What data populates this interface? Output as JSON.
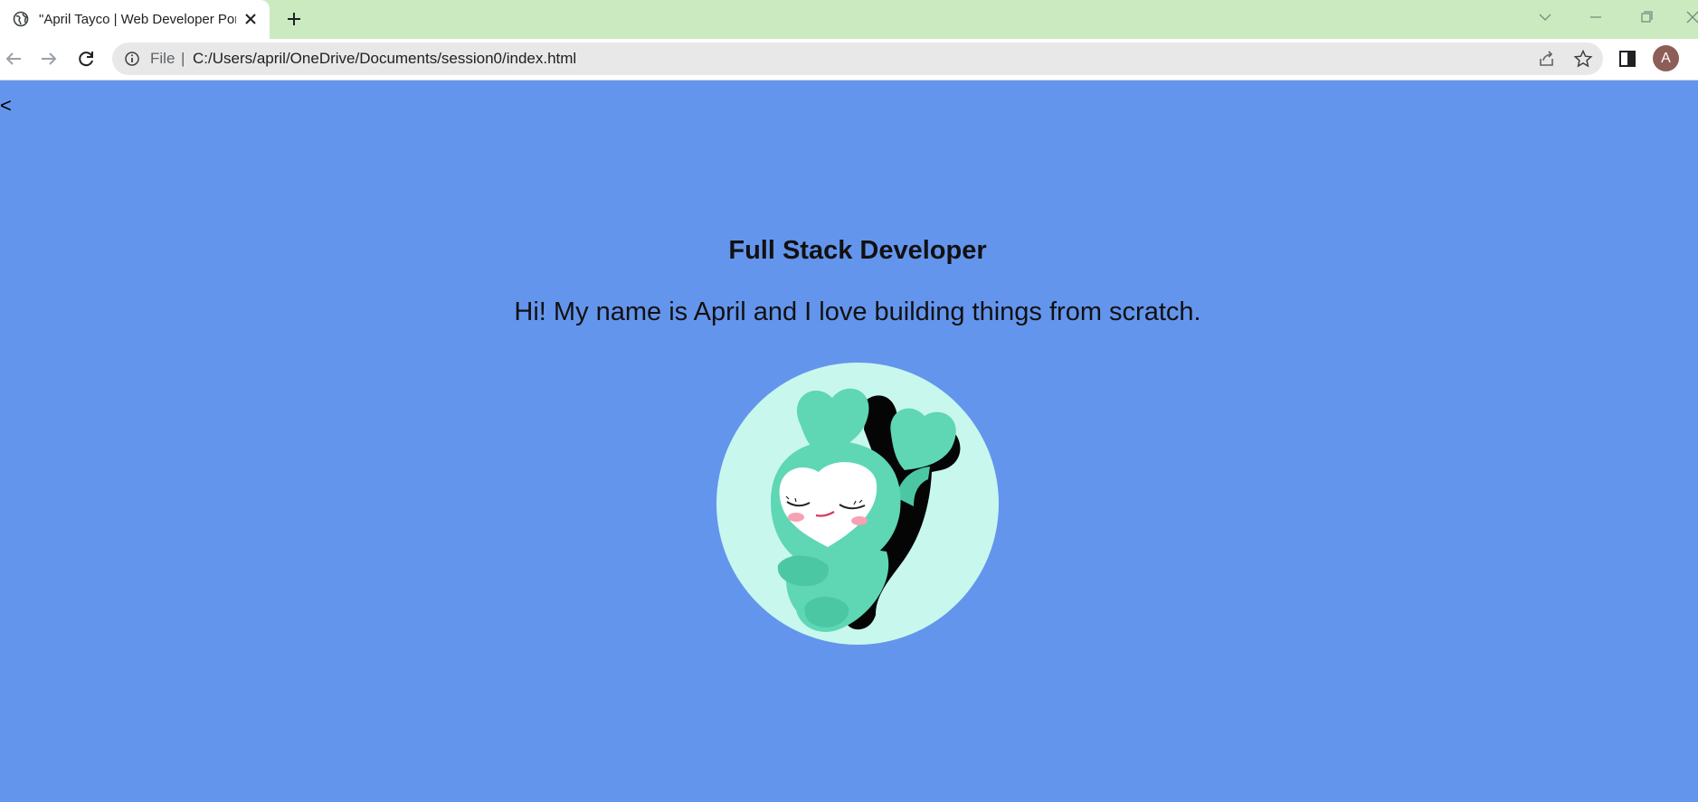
{
  "browser": {
    "tab": {
      "title": "\"April Tayco | Web Developer Portfolio\"",
      "favicon": "globe-icon",
      "close_icon": "close-icon"
    },
    "new_tab_icon": "plus-icon",
    "window_controls": [
      "chevron-down-icon",
      "minimize-icon",
      "restore-icon",
      "close-icon"
    ],
    "toolbar": {
      "back_icon": "arrow-left-icon",
      "forward_icon": "arrow-right-icon",
      "reload_icon": "reload-icon",
      "address": {
        "info_icon": "info-icon",
        "scheme_chip": "File",
        "separator": "|",
        "url": "C:/Users/april/OneDrive/Documents/session0/index.html"
      },
      "share_icon": "share-icon",
      "bookmark_icon": "star-icon",
      "side_panel_icon": "side-panel-icon",
      "profile_initial": "A"
    },
    "colors": {
      "tabstrip": "#cbeac0",
      "page_background": "#6495ed",
      "avatar": "#8c5e57",
      "illustration_circle": "#c8f7ee",
      "illustration_body": "#5fd6b4"
    }
  },
  "page": {
    "stray_text": "<",
    "title": "Full Stack Developer",
    "intro": "Hi! My name is April and I love building things from scratch.",
    "hero_image": "heart-character-illustration"
  }
}
